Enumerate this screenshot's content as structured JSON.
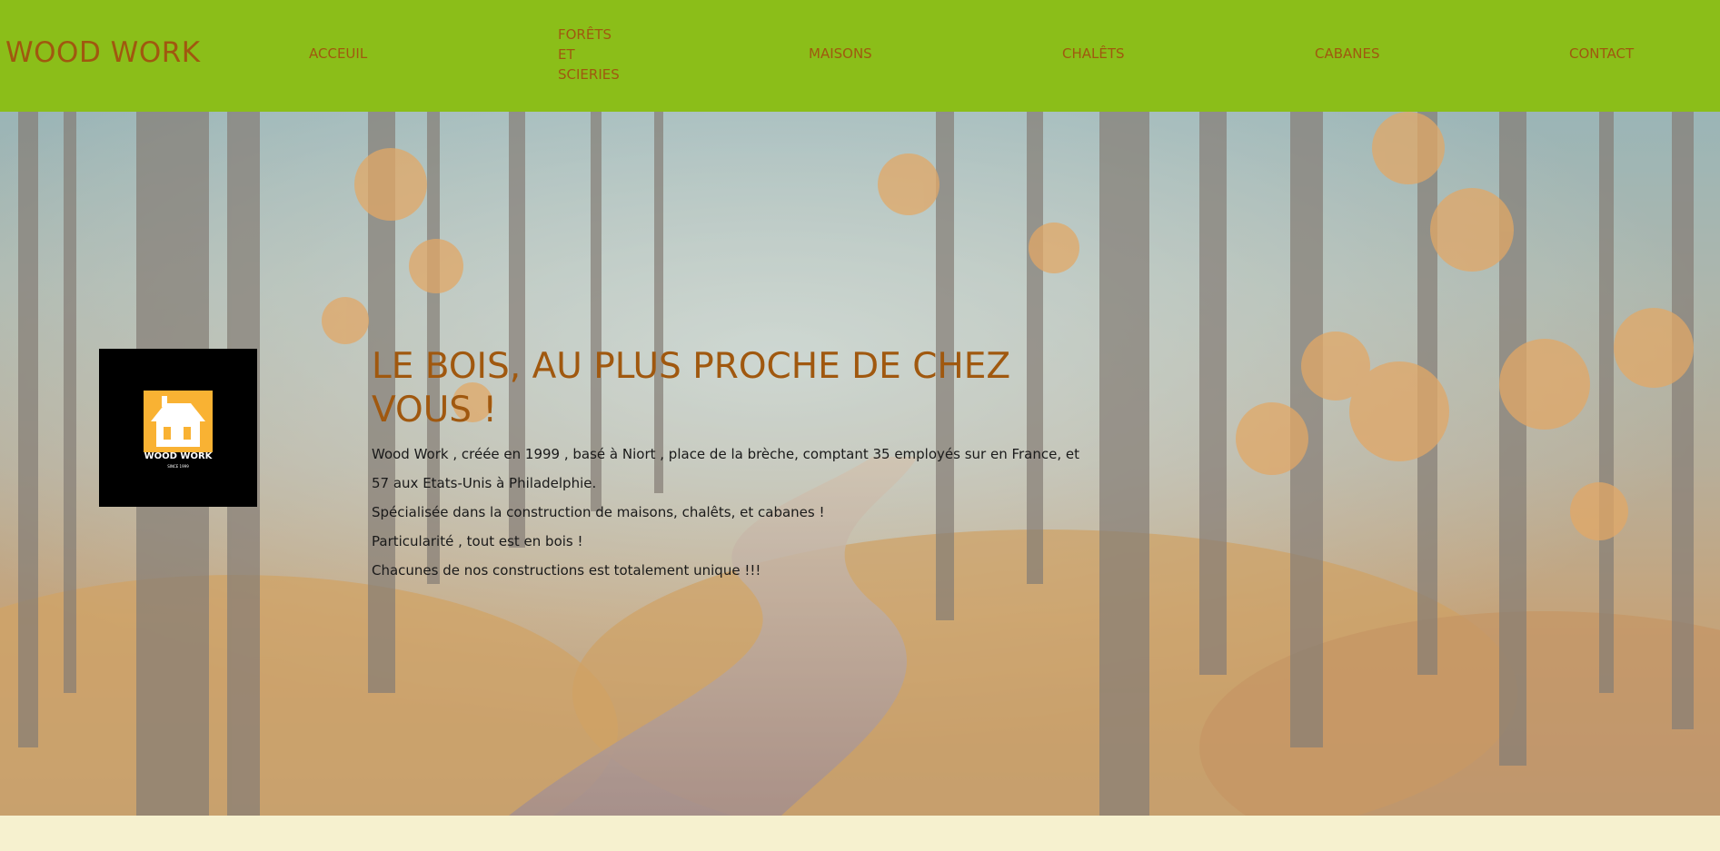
{
  "brand": {
    "name": "WOOD WORK"
  },
  "nav": {
    "items": [
      {
        "label": "ACCEUIL"
      },
      {
        "label_lines": [
          "FORÊTS",
          "ET",
          "SCIERIES"
        ]
      },
      {
        "label": "MAISONS"
      },
      {
        "label": "CHALÊTS"
      },
      {
        "label": "CABANES"
      },
      {
        "label": "CONTACT"
      }
    ]
  },
  "logo": {
    "name": "WOOD WORK",
    "since": "SINCE 1999"
  },
  "hero": {
    "headline_lines": [
      "LE BOIS, AU PLUS PROCHE DE CHEZ",
      "VOUS !"
    ],
    "paragraphs": [
      "Wood Work , créée en 1999 , basé à Niort , place de la brèche, comptant 35 employés sur en France, et 57 aux Etats-Unis à Philadelphie.",
      "Spécialisée dans la construction de maisons, chalêts, et cabanes !",
      "Particularité , tout est en bois !",
      "Chacunes de nos constructions est totalement unique !!!"
    ]
  },
  "colors": {
    "header_bg": "#8bbe19",
    "brand_text": "#a0580f",
    "page_bg": "#f6f1cf",
    "logo_orange": "#f9b233"
  }
}
